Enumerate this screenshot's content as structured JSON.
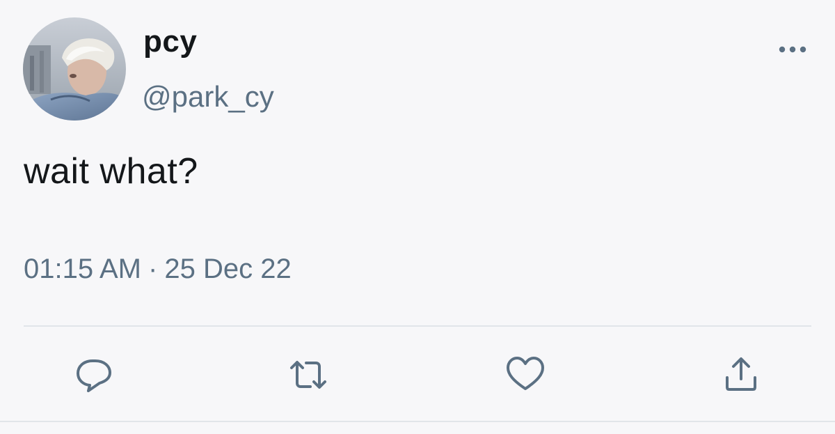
{
  "user": {
    "display_name": "pcy",
    "handle": "@park_cy",
    "avatar_icon": "profile-photo"
  },
  "tweet": {
    "text": "wait what?",
    "time": "01:15 AM",
    "separator": "·",
    "date": "25 Dec 22"
  },
  "actions": [
    {
      "name": "reply",
      "icon": "reply-icon"
    },
    {
      "name": "retweet",
      "icon": "retweet-icon"
    },
    {
      "name": "like",
      "icon": "heart-icon"
    },
    {
      "name": "share",
      "icon": "share-icon"
    }
  ],
  "colors": {
    "background": "#f7f7f9",
    "primary_text": "#14171a",
    "secondary_text": "#5b7083",
    "divider": "#e1e5e9"
  }
}
